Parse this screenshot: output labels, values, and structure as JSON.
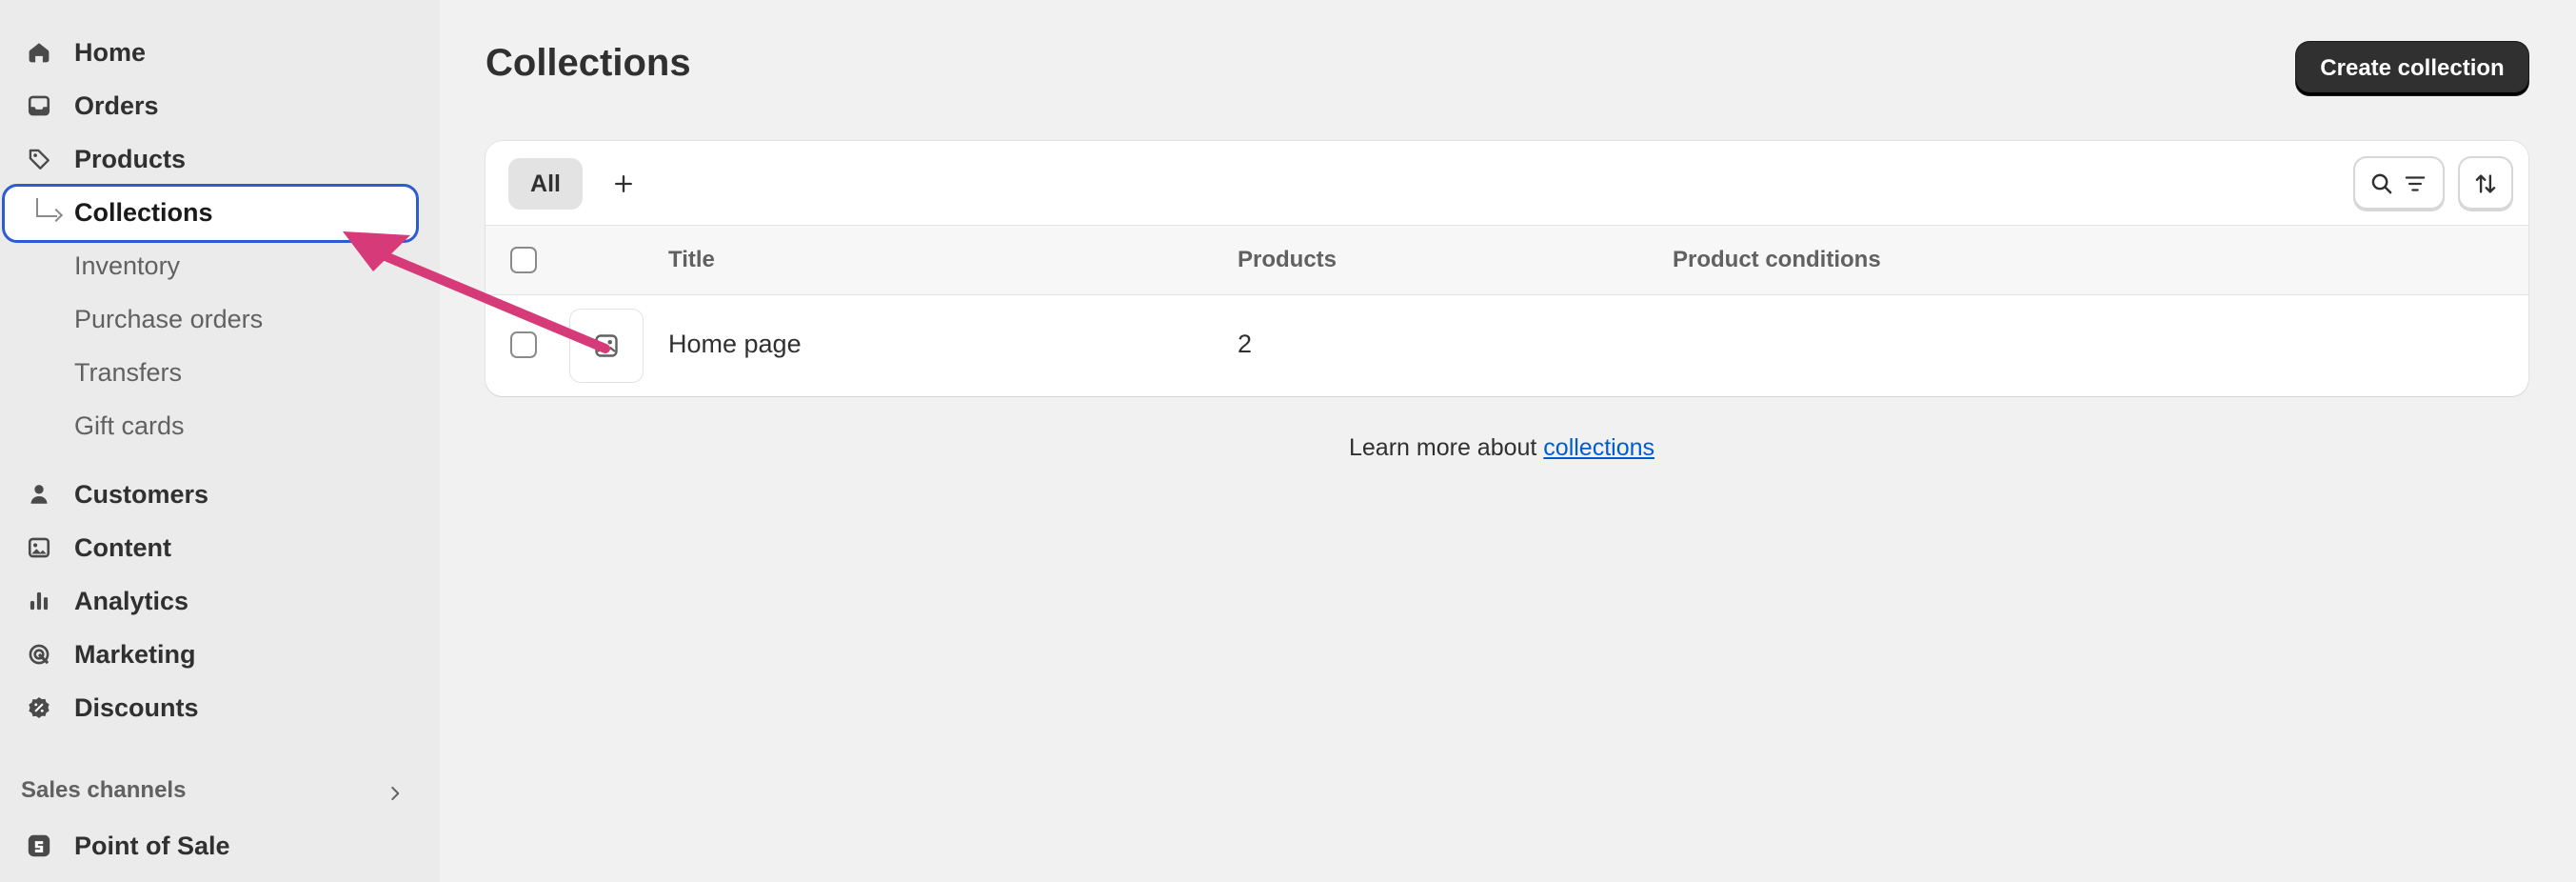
{
  "sidebar": {
    "items": [
      {
        "label": "Home",
        "icon": "home-icon"
      },
      {
        "label": "Orders",
        "icon": "inbox-icon"
      },
      {
        "label": "Products",
        "icon": "tag-icon"
      },
      {
        "label": "Collections",
        "icon": "subitem-elbow-icon"
      },
      {
        "label": "Inventory"
      },
      {
        "label": "Purchase orders"
      },
      {
        "label": "Transfers"
      },
      {
        "label": "Gift cards"
      },
      {
        "label": "Customers",
        "icon": "person-icon"
      },
      {
        "label": "Content",
        "icon": "content-icon"
      },
      {
        "label": "Analytics",
        "icon": "bar-chart-icon"
      },
      {
        "label": "Marketing",
        "icon": "target-icon"
      },
      {
        "label": "Discounts",
        "icon": "discount-badge-icon"
      }
    ],
    "section_label": "Sales channels",
    "channels": [
      {
        "label": "Point of Sale",
        "icon": "pos-icon"
      }
    ]
  },
  "header": {
    "title": "Collections",
    "create_button": "Create collection"
  },
  "card": {
    "tabs": [
      {
        "label": "All",
        "selected": true
      }
    ],
    "columns": [
      "Title",
      "Products",
      "Product conditions"
    ],
    "rows": [
      {
        "title": "Home page",
        "products": "2",
        "conditions": ""
      }
    ]
  },
  "footer": {
    "learn_more_prefix": "Learn more about ",
    "learn_more_link": "collections"
  },
  "colors": {
    "accent_focus": "#2c5bd4",
    "primary_button": "#303030",
    "link": "#005bd3",
    "annotation_arrow": "#d63a79"
  }
}
